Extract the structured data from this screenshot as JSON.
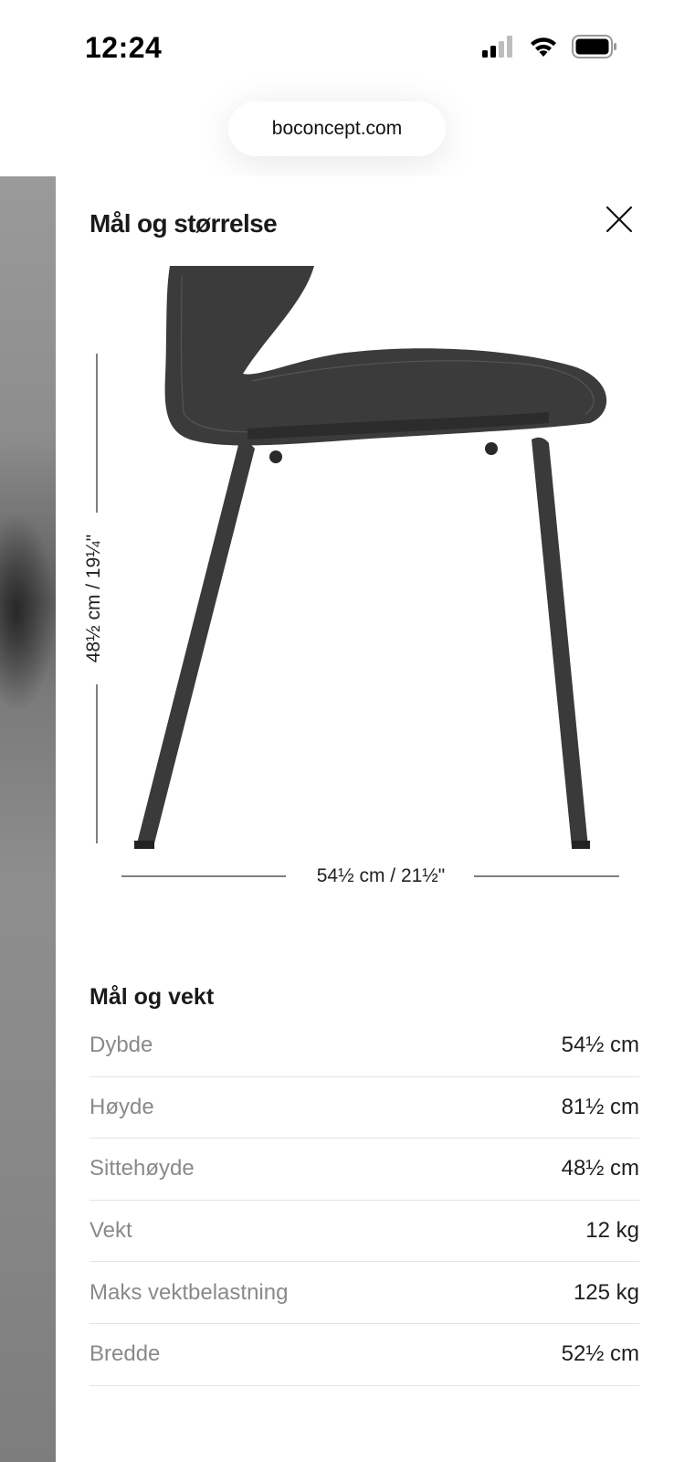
{
  "status_bar": {
    "time": "12:24",
    "icons": [
      "cellular-signal-icon",
      "wifi-icon",
      "battery-icon"
    ]
  },
  "browser": {
    "url": "boconcept.com"
  },
  "drawer": {
    "title": "Mål og størrelse",
    "close_icon": "close-icon",
    "diagram": {
      "height_dimension": "48½ cm / 19¼\"",
      "width_dimension": "54½ cm / 21½\""
    },
    "specs": {
      "heading": "Mål og vekt",
      "rows": [
        {
          "label": "Dybde",
          "value": "54½ cm"
        },
        {
          "label": "Høyde",
          "value": "81½ cm"
        },
        {
          "label": "Sittehøyde",
          "value": "48½ cm"
        },
        {
          "label": "Vekt",
          "value": "12 kg"
        },
        {
          "label": "Maks vektbelastning",
          "value": "125 kg"
        },
        {
          "label": "Bredde",
          "value": "52½ cm"
        }
      ]
    }
  },
  "colors": {
    "text_primary": "#1a1a1a",
    "text_secondary": "#8a8a8a",
    "chair": "#3a3a3a",
    "divider": "#e4e4e4"
  }
}
